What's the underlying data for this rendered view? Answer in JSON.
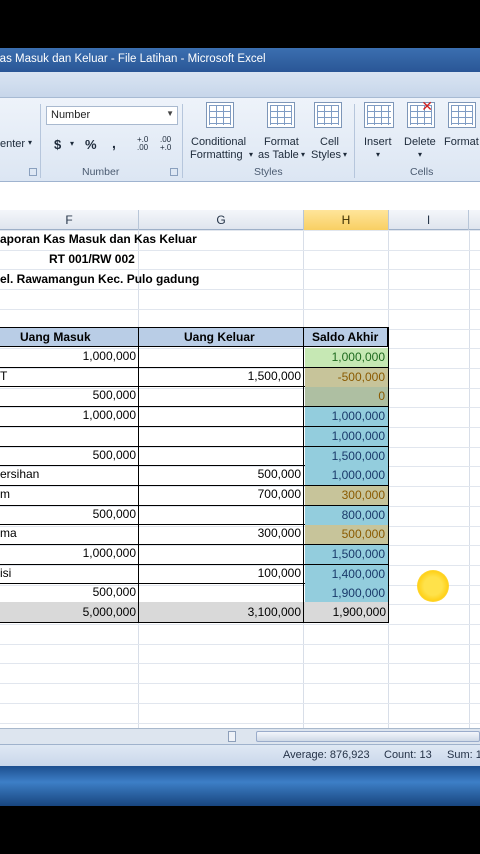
{
  "window": {
    "title": "Kas Masuk dan Keluar - File Latihan  -  Microsoft Excel"
  },
  "ribbon": {
    "alignment_partial": "enter",
    "number_format": "Number",
    "currency_symbol": "$",
    "percent_symbol": "%",
    "comma_symbol": ",",
    "inc_decimal": "+.0 .00",
    "dec_decimal": ".00 +.0",
    "number_group_label": "Number",
    "conditional_formatting_line1": "Conditional",
    "conditional_formatting_line2": "Formatting",
    "format_table_line1": "Format",
    "format_table_line2": "as Table",
    "cell_styles_line1": "Cell",
    "cell_styles_line2": "Styles",
    "styles_group_label": "Styles",
    "insert_label": "Insert",
    "delete_label": "Delete",
    "format_label": "Format",
    "cells_group_label": "Cells"
  },
  "columns": [
    "F",
    "G",
    "H",
    "I"
  ],
  "sheet": {
    "title1": "aporan Kas Masuk dan Kas Keluar",
    "title2": "RT 001/RW 002",
    "title3": "el. Rawamangun Kec. Pulo gadung",
    "headers": {
      "masuk": "Uang Masuk",
      "keluar": "Uang Keluar",
      "saldo": "Saldo Akhir"
    },
    "rows": [
      {
        "desc": "",
        "masuk": "1,000,000",
        "keluar": "",
        "saldo": "1,000,000",
        "tone": "green"
      },
      {
        "desc": "T",
        "masuk": "",
        "keluar": "1,500,000",
        "saldo": "-500,000",
        "tone": "tan"
      },
      {
        "desc": "",
        "masuk": "500,000",
        "keluar": "",
        "saldo": "0",
        "tone": "olive"
      },
      {
        "desc": "",
        "masuk": "1,000,000",
        "keluar": "",
        "saldo": "1,000,000",
        "tone": "blue"
      },
      {
        "desc": "",
        "masuk": "",
        "keluar": "",
        "saldo": "1,000,000",
        "tone": "blue"
      },
      {
        "desc": "",
        "masuk": "500,000",
        "keluar": "",
        "saldo": "1,500,000",
        "tone": "blue"
      },
      {
        "desc": "ersihan",
        "masuk": "",
        "keluar": "500,000",
        "saldo": "1,000,000",
        "tone": "blue"
      },
      {
        "desc": "m",
        "masuk": "",
        "keluar": "700,000",
        "saldo": "300,000",
        "tone": "tan"
      },
      {
        "desc": "",
        "masuk": "500,000",
        "keluar": "",
        "saldo": "800,000",
        "tone": "blue"
      },
      {
        "desc": "ma",
        "masuk": "",
        "keluar": "300,000",
        "saldo": "500,000",
        "tone": "tan"
      },
      {
        "desc": "",
        "masuk": "1,000,000",
        "keluar": "",
        "saldo": "1,500,000",
        "tone": "blue"
      },
      {
        "desc": "isi",
        "masuk": "",
        "keluar": "100,000",
        "saldo": "1,400,000",
        "tone": "blue"
      },
      {
        "desc": "",
        "masuk": "500,000",
        "keluar": "",
        "saldo": "1,900,000",
        "tone": "blue"
      }
    ],
    "total": {
      "masuk": "5,000,000",
      "keluar": "3,100,000",
      "saldo": "1,900,000"
    }
  },
  "status": {
    "average": "Average: 876,923",
    "count": "Count: 13",
    "sum": "Sum: 1"
  },
  "colors": {
    "green": "#c6e8b4",
    "tan": "#c7c49a",
    "olive": "#aebfa2",
    "blue": "#93cddd"
  }
}
